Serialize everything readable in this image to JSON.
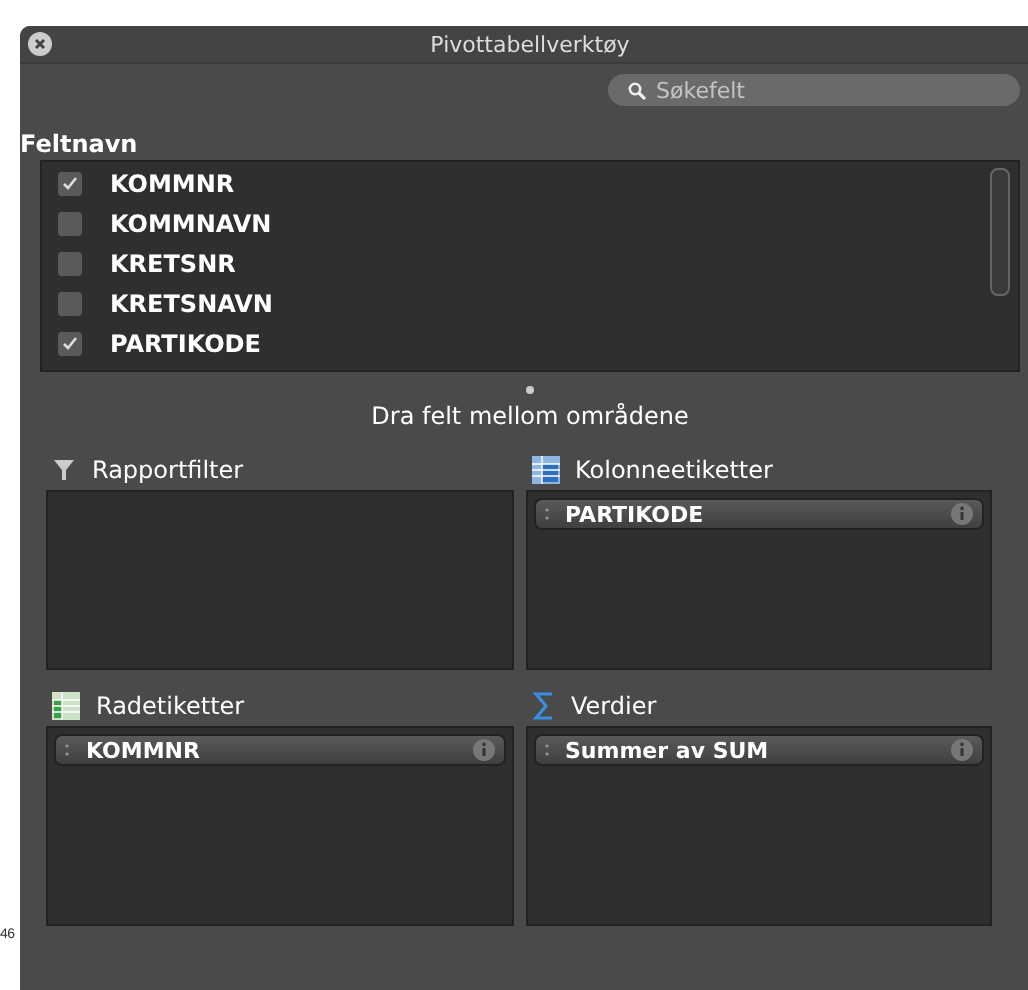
{
  "window": {
    "title": "Pivottabellverktøy"
  },
  "search": {
    "placeholder": "Søkefelt"
  },
  "fields_label": "Feltnavn",
  "fields": [
    {
      "name": "KOMMNR",
      "checked": true
    },
    {
      "name": "KOMMNAVN",
      "checked": false
    },
    {
      "name": "KRETSNR",
      "checked": false
    },
    {
      "name": "KRETSNAVN",
      "checked": false
    },
    {
      "name": "PARTIKODE",
      "checked": true
    }
  ],
  "hint": "Dra felt mellom områdene",
  "areas": [
    {
      "kind": "filter",
      "title": "Rapportfilter"
    },
    {
      "kind": "columns",
      "title": "Kolonneetiketter",
      "items": [
        "PARTIKODE"
      ]
    },
    {
      "kind": "rows",
      "title": "Radetiketter",
      "items": [
        "KOMMNR"
      ]
    },
    {
      "kind": "values",
      "title": "Verdier",
      "items": [
        "Summer av SUM"
      ]
    }
  ],
  "background_text": "46"
}
